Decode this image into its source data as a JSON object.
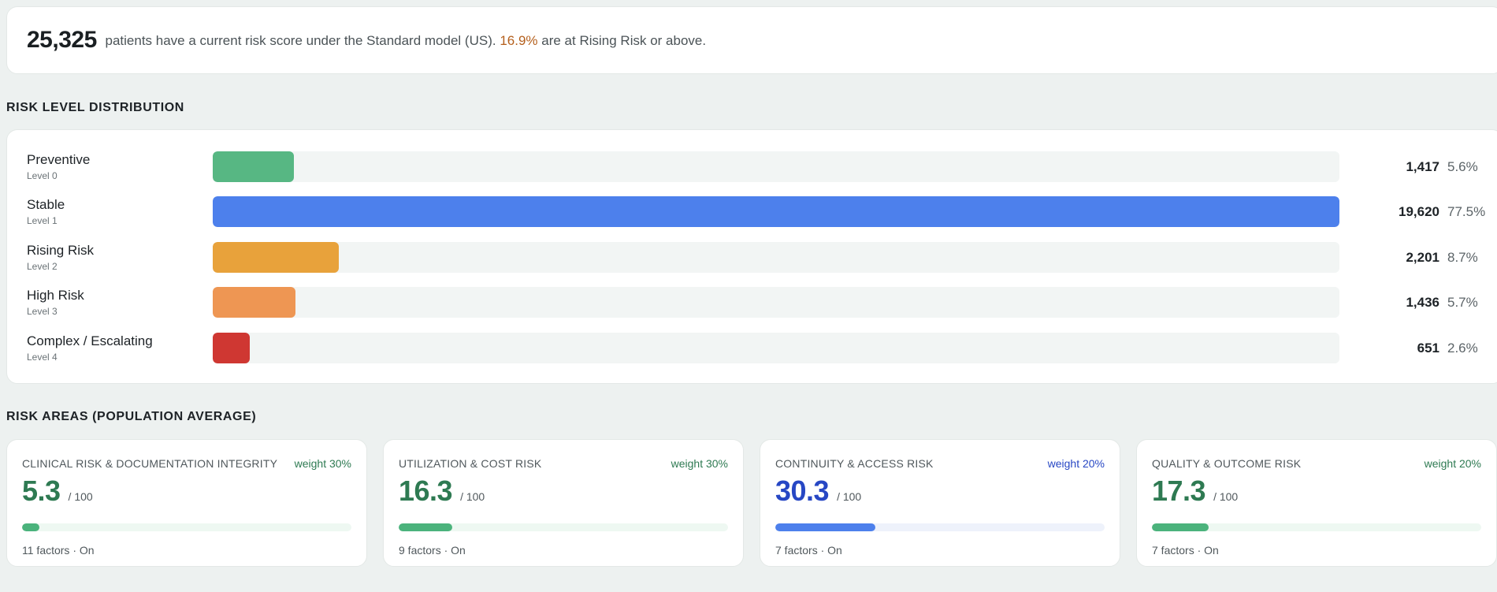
{
  "summary": {
    "count": "25,325",
    "text_before": "patients have a current risk score under the Standard model (US).",
    "highlight_pct": "16.9%",
    "text_after": "are at Rising Risk or above.",
    "highlight_color": "#b45f1c"
  },
  "distribution": {
    "title": "RISK LEVEL DISTRIBUTION",
    "max_count": 19620,
    "rows": [
      {
        "name": "Preventive",
        "level": "Level 0",
        "count": "1,417",
        "value": 1417,
        "pct": "5.6%",
        "color": "#57b783"
      },
      {
        "name": "Stable",
        "level": "Level 1",
        "count": "19,620",
        "value": 19620,
        "pct": "77.5%",
        "color": "#4d80ec"
      },
      {
        "name": "Rising Risk",
        "level": "Level 2",
        "count": "2,201",
        "value": 2201,
        "pct": "8.7%",
        "color": "#e8a23b"
      },
      {
        "name": "High Risk",
        "level": "Level 3",
        "count": "1,436",
        "value": 1436,
        "pct": "5.7%",
        "color": "#ee9653"
      },
      {
        "name": "Complex / Escalating",
        "level": "Level 4",
        "count": "651",
        "value": 651,
        "pct": "2.6%",
        "color": "#cf3732"
      }
    ]
  },
  "areas": {
    "title": "RISK AREAS (POPULATION AVERAGE)",
    "max_label": "/ 100",
    "items": [
      {
        "title": "CLINICAL RISK & DOCUMENTATION INTEGRITY",
        "weight": "weight 30%",
        "score": "5.3",
        "value": 5.3,
        "footer": "11 factors · On",
        "accent": "#2e7a52",
        "fill": "#4bb37c",
        "track": "#eef8f2"
      },
      {
        "title": "UTILIZATION & COST RISK",
        "weight": "weight 30%",
        "score": "16.3",
        "value": 16.3,
        "footer": "9 factors · On",
        "accent": "#2e7a52",
        "fill": "#4bb37c",
        "track": "#eef8f2"
      },
      {
        "title": "CONTINUITY & ACCESS RISK",
        "weight": "weight 20%",
        "score": "30.3",
        "value": 30.3,
        "footer": "7 factors · On",
        "accent": "#2747c4",
        "fill": "#4d80ec",
        "track": "#eef2fb"
      },
      {
        "title": "QUALITY & OUTCOME RISK",
        "weight": "weight 20%",
        "score": "17.3",
        "value": 17.3,
        "footer": "7 factors · On",
        "accent": "#2e7a52",
        "fill": "#4bb37c",
        "track": "#eef8f2"
      }
    ]
  }
}
